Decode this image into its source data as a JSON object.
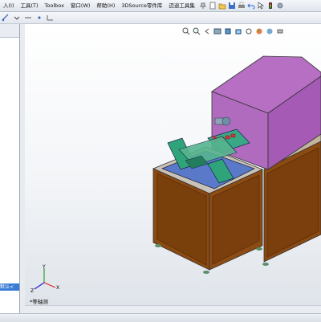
{
  "menubar": {
    "items": [
      "入(I)",
      "工具(T)",
      "Toolbox",
      "窗口(W)",
      "帮助(H)",
      "3DSource零件库",
      "迈迪工具集"
    ]
  },
  "sidebar": {
    "active_label": "默认<"
  },
  "viewport": {
    "view_label": "*等轴测",
    "triad_axes": [
      "Y",
      "X",
      "Z"
    ]
  },
  "colors": {
    "cabinet_wood": "#8a4a12",
    "enclosure": "#b06bbf",
    "green_parts": "#2fa37a",
    "fixture_red": "#d8323a",
    "tabletop": "#5a79c8"
  }
}
